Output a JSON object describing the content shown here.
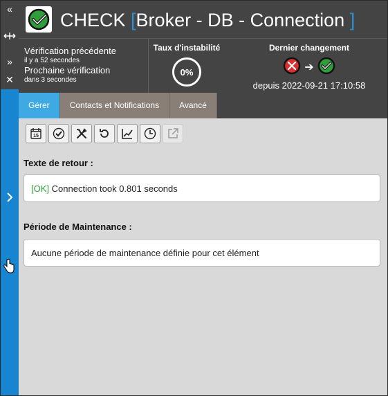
{
  "leftbar": {
    "icons": [
      "collapse-all-icon",
      "resize-horizontal-icon",
      "expand-icon",
      "close-icon",
      "chevron-right-icon"
    ]
  },
  "header": {
    "check_word": "CHECK",
    "bracket_open": "[",
    "bracket_close": "]",
    "name": "Broker - DB - Connection",
    "status_color": "#2e9d3a"
  },
  "info": {
    "previous_label": "Vérification précédente",
    "previous_value": "il y a 52 secondes",
    "next_label": "Prochaine vérification",
    "next_value": "dans 3 secondes",
    "instability_label": "Taux d'instabilité",
    "instability_value": "0%",
    "last_change_label": "Dernier changement",
    "last_change_from": "error-icon",
    "last_change_to": "ok-icon",
    "last_change_since": "depuis 2022-09-21 17:10:58"
  },
  "tabs": [
    {
      "label": "Gérer",
      "active": true
    },
    {
      "label": "Contacts et Notifications",
      "active": false
    },
    {
      "label": "Avancé",
      "active": false
    }
  ],
  "toolbar": {
    "icons": [
      "calendar-icon",
      "acknowledge-icon",
      "tools-icon",
      "recheck-icon",
      "graph-icon",
      "history-icon",
      "external-link-icon"
    ]
  },
  "return_text": {
    "title": "Texte de retour :",
    "status": "[OK]",
    "message": "Connection took 0.801 seconds"
  },
  "maintenance": {
    "title": "Période de Maintenance :",
    "message": "Aucune période de maintenance définie pour cet élément"
  }
}
